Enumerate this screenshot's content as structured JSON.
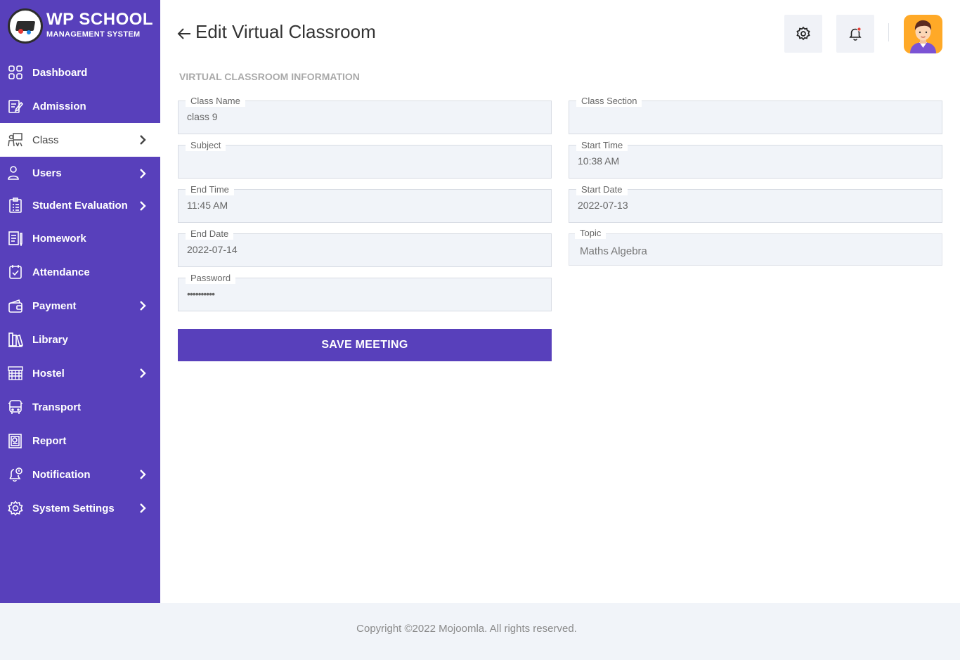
{
  "brand": {
    "title": "WP SCHOOL",
    "subtitle": "MANAGEMENT SYSTEM"
  },
  "sidebar": {
    "items": [
      {
        "label": "Dashboard",
        "icon": "dashboard-icon",
        "has_submenu": false,
        "active": false
      },
      {
        "label": "Admission",
        "icon": "admission-icon",
        "has_submenu": false,
        "active": false
      },
      {
        "label": "Class",
        "icon": "class-icon",
        "has_submenu": true,
        "active": true
      },
      {
        "label": "Users",
        "icon": "users-icon",
        "has_submenu": true,
        "active": false
      },
      {
        "label": "Student Evaluation",
        "icon": "evaluation-icon",
        "has_submenu": true,
        "active": false
      },
      {
        "label": "Homework",
        "icon": "homework-icon",
        "has_submenu": false,
        "active": false
      },
      {
        "label": "Attendance",
        "icon": "attendance-icon",
        "has_submenu": false,
        "active": false
      },
      {
        "label": "Payment",
        "icon": "payment-icon",
        "has_submenu": true,
        "active": false
      },
      {
        "label": "Library",
        "icon": "library-icon",
        "has_submenu": false,
        "active": false
      },
      {
        "label": "Hostel",
        "icon": "hostel-icon",
        "has_submenu": true,
        "active": false
      },
      {
        "label": "Transport",
        "icon": "transport-icon",
        "has_submenu": false,
        "active": false
      },
      {
        "label": "Report",
        "icon": "report-icon",
        "has_submenu": false,
        "active": false
      },
      {
        "label": "Notification",
        "icon": "notification-icon",
        "has_submenu": true,
        "active": false
      },
      {
        "label": "System Settings",
        "icon": "system-settings-icon",
        "has_submenu": true,
        "active": false
      }
    ]
  },
  "header": {
    "title": "Edit Virtual Classroom",
    "back_icon": "arrow-left-icon",
    "settings_icon": "gear-icon",
    "notification_icon": "bell-icon"
  },
  "form": {
    "section_heading": "VIRTUAL CLASSROOM INFORMATION",
    "class_name": {
      "label": "Class Name",
      "value": "class 9"
    },
    "class_section": {
      "label": "Class Section",
      "value": ""
    },
    "subject": {
      "label": "Subject",
      "value": ""
    },
    "start_time": {
      "label": "Start Time",
      "value": "10:38 AM"
    },
    "end_time": {
      "label": "End Time",
      "value": "11:45 AM"
    },
    "start_date": {
      "label": "Start Date",
      "value": "2022-07-13"
    },
    "end_date": {
      "label": "End Date",
      "value": "2022-07-14"
    },
    "topic": {
      "label": "Topic",
      "value": "Maths Algebra"
    },
    "password": {
      "label": "Password",
      "value": "••••••••••"
    },
    "save_label": "SAVE MEETING"
  },
  "footer": {
    "text": "Copyright ©2022 Mojoomla. All rights reserved."
  },
  "colors": {
    "primary": "#5840bb",
    "field_bg": "#f1f4f9",
    "footer_bg": "#f1f4f9",
    "avatar_bg": "#ffa927",
    "notification_dot": "#e8453c"
  }
}
